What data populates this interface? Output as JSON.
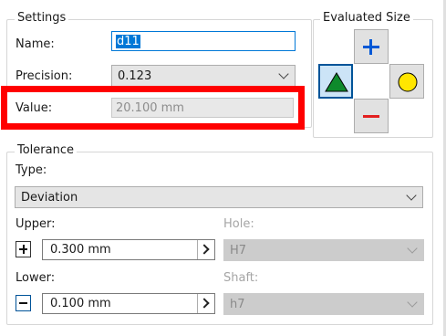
{
  "settings": {
    "title": "Settings",
    "name_label": "Name:",
    "name_value": "d11",
    "precision_label": "Precision:",
    "precision_value": "0.123",
    "value_label": "Value:",
    "value_value": "20.100 mm"
  },
  "evaluated_size": {
    "title": "Evaluated Size",
    "buttons": {
      "upper": "plus-icon",
      "nominal": "triangle-icon",
      "median": "circle-icon",
      "lower": "minus-icon"
    },
    "active": "nominal"
  },
  "tolerance": {
    "title": "Tolerance",
    "type_label": "Type:",
    "type_value": "Deviation",
    "upper_label": "Upper:",
    "upper_sign": "+",
    "upper_value": "0.300 mm",
    "lower_label": "Lower:",
    "lower_sign": "−",
    "lower_value": "0.100 mm",
    "hole_label": "Hole:",
    "hole_value": "H7",
    "shaft_label": "Shaft:",
    "shaft_value": "h7"
  },
  "colors": {
    "highlight": "#ff0000",
    "plus": "#0058d6",
    "minus": "#e32020",
    "triangle": "#0e8a2c",
    "circle": "#ffe600"
  }
}
